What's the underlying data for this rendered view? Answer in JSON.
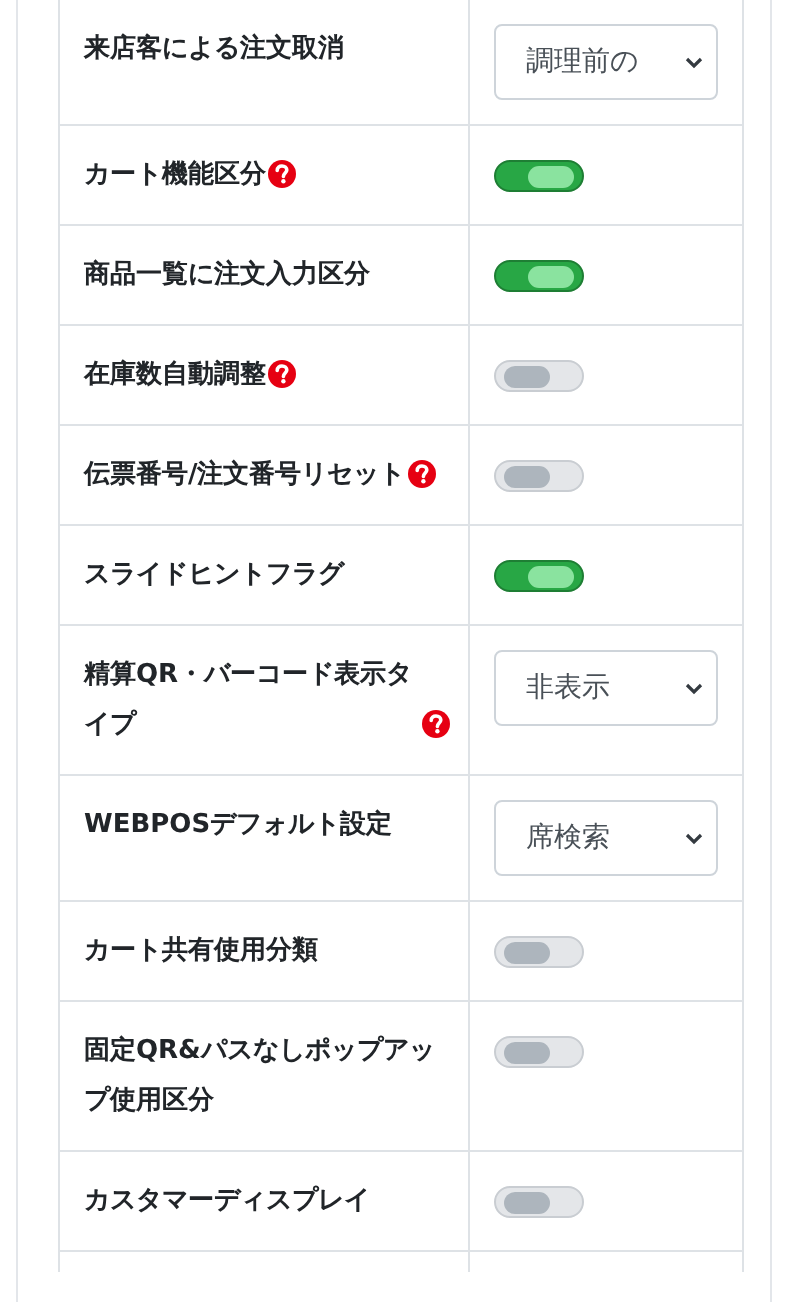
{
  "settings": [
    {
      "label": "来店客による注文取消",
      "help": false,
      "kind": "select",
      "value": "調理前の"
    },
    {
      "label": "カート機能区分",
      "help": true,
      "kind": "toggle",
      "on": true
    },
    {
      "label": "商品一覧に注文入力区分",
      "help": false,
      "kind": "toggle",
      "on": true
    },
    {
      "label": "在庫数自動調整",
      "help": true,
      "kind": "toggle",
      "on": false
    },
    {
      "label": "伝票番号/注文番号リセット",
      "help": true,
      "kind": "toggle",
      "on": false
    },
    {
      "label": "スライドヒントフラグ",
      "help": false,
      "kind": "toggle",
      "on": true
    },
    {
      "label": "精算QR・バーコード表示タイプ",
      "help": true,
      "kind": "select",
      "value": "非表示"
    },
    {
      "label": "WEBPOSデフォルト設定",
      "help": false,
      "kind": "select",
      "value": "席検索"
    },
    {
      "label": "カート共有使用分類",
      "help": false,
      "kind": "toggle",
      "on": false
    },
    {
      "label": "固定QR&パスなしポップアップ使用区分",
      "help": false,
      "kind": "toggle",
      "on": false
    },
    {
      "label": "カスタマーディスプレイ",
      "help": false,
      "kind": "toggle",
      "on": false
    }
  ]
}
